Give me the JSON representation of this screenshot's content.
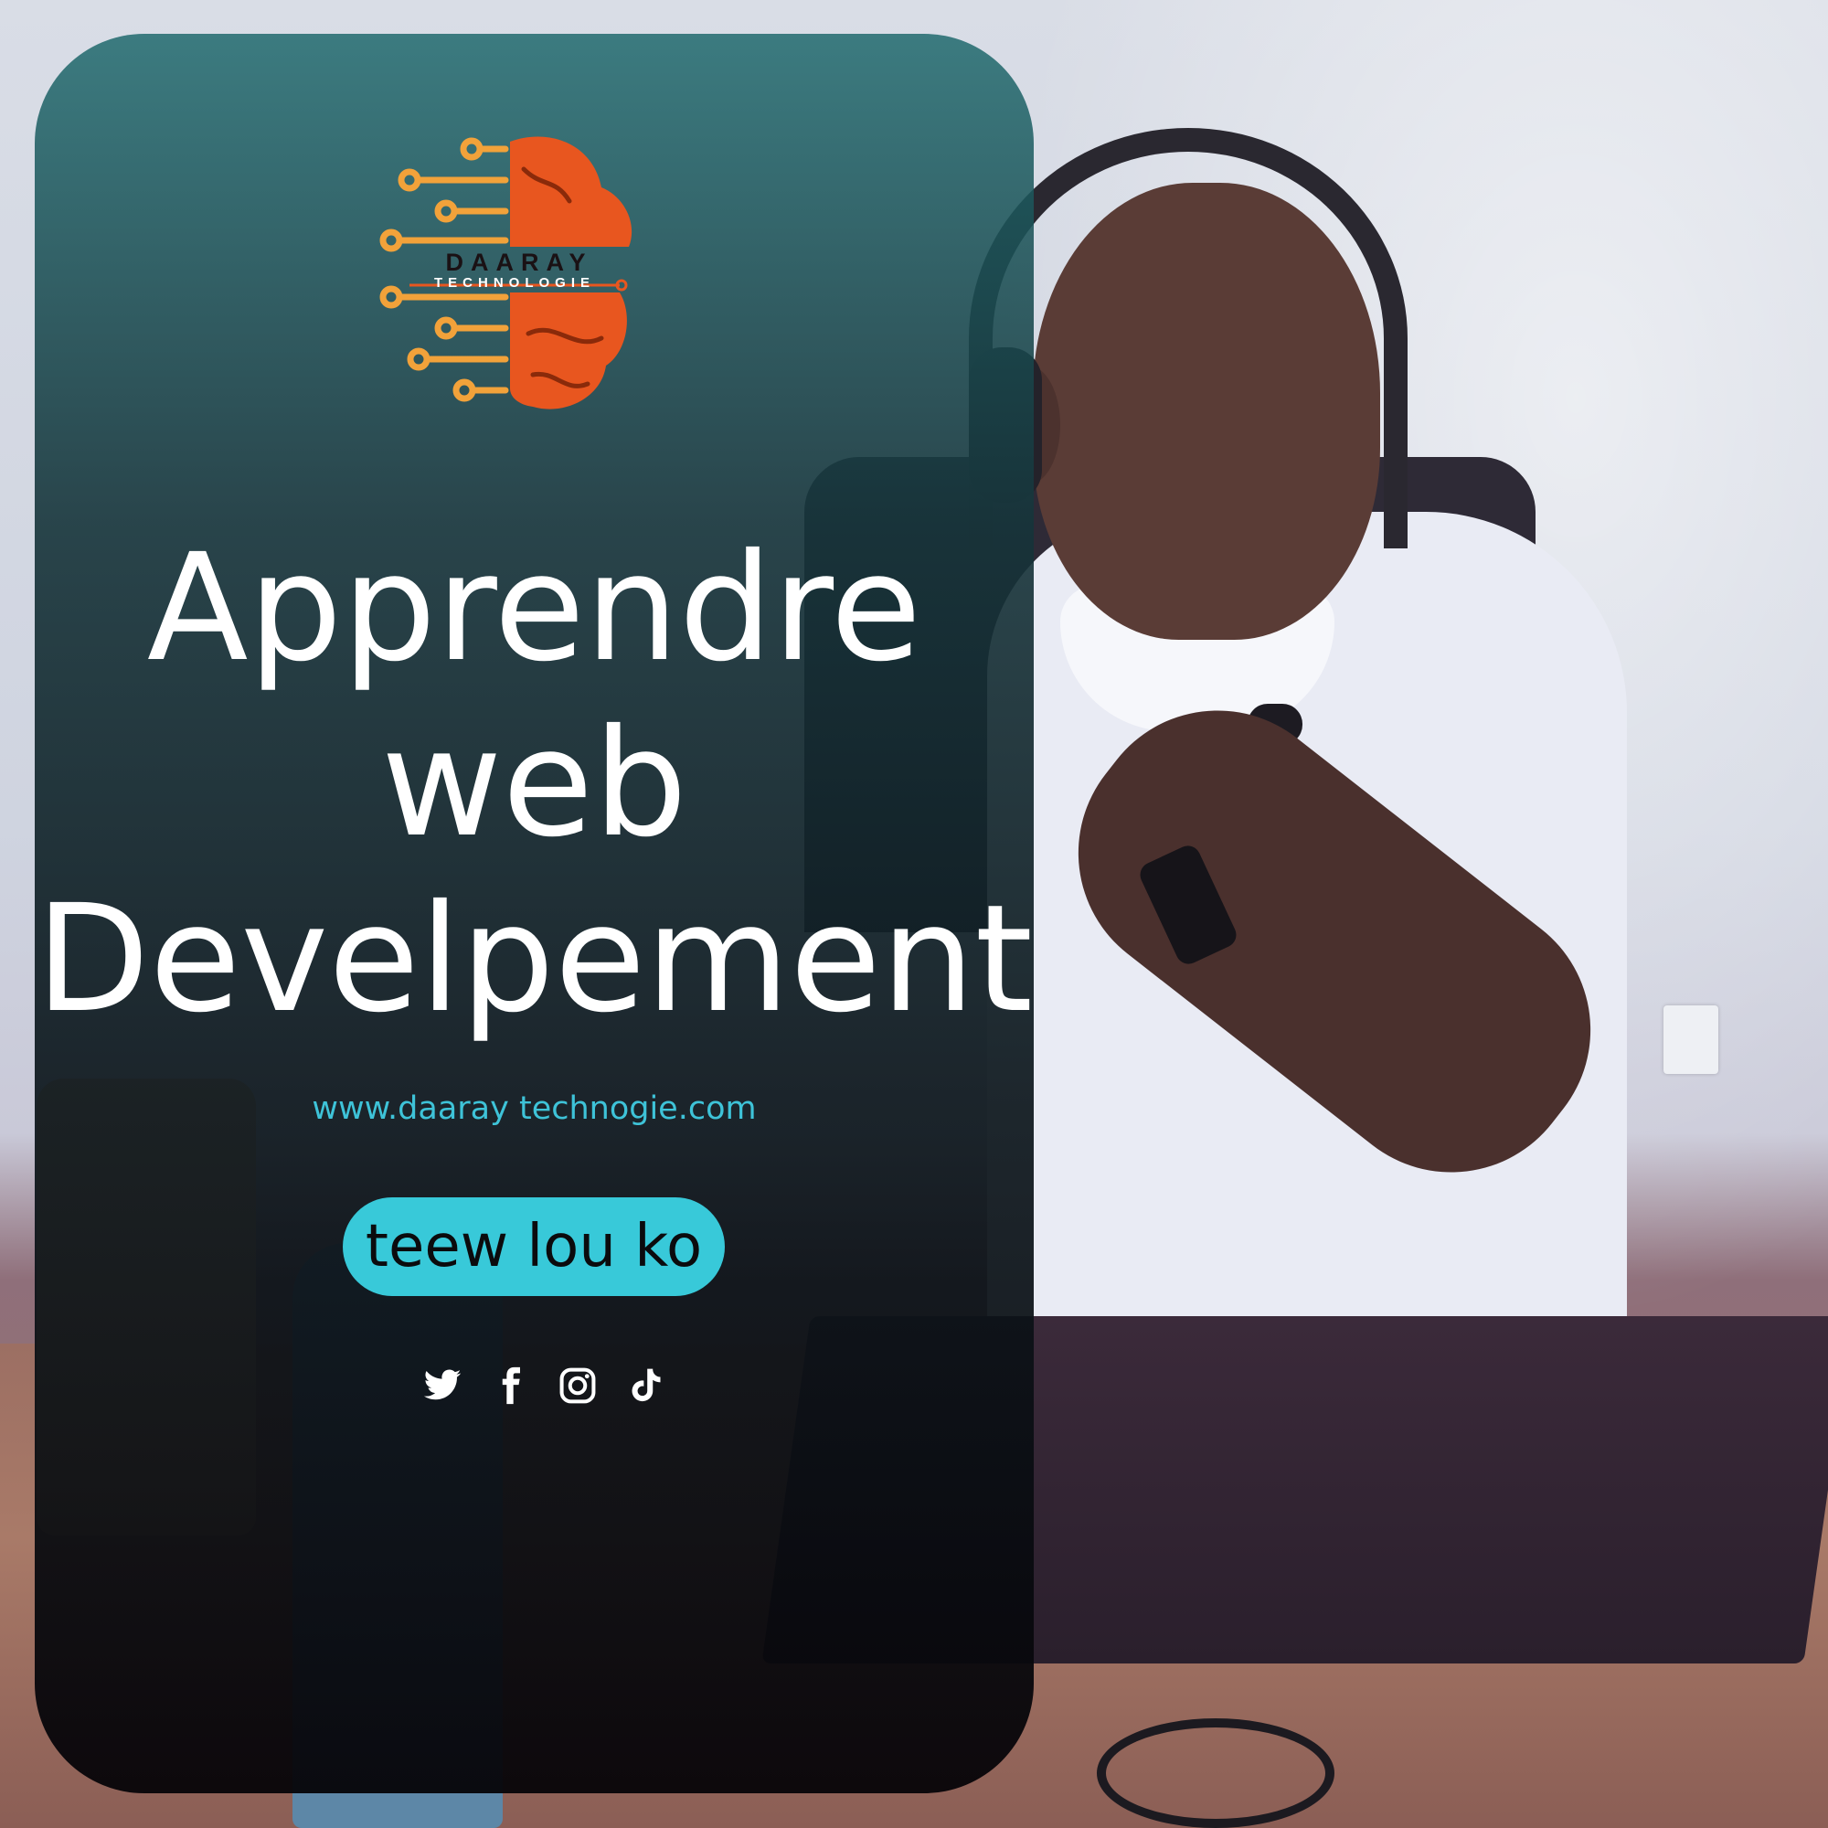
{
  "brand": {
    "name": "DAARAY",
    "tagline": "TECHNOLOGIE",
    "colors": {
      "brain": "#e8561f",
      "circuit": "#f2a23a"
    }
  },
  "headline": {
    "line1": "Apprendre",
    "line2": "web",
    "line3": "Develpement"
  },
  "website": "www.daaray technogie.com",
  "cta": {
    "label": "teew lou ko",
    "color": "#38c9d9"
  },
  "social": [
    {
      "name": "twitter",
      "icon": "twitter-icon"
    },
    {
      "name": "facebook",
      "icon": "facebook-icon"
    },
    {
      "name": "instagram",
      "icon": "instagram-icon"
    },
    {
      "name": "tiktok",
      "icon": "tiktok-icon"
    }
  ],
  "colors": {
    "headline": "#ffffff",
    "url": "#3ec3d8",
    "panel": "#0e1a20"
  }
}
